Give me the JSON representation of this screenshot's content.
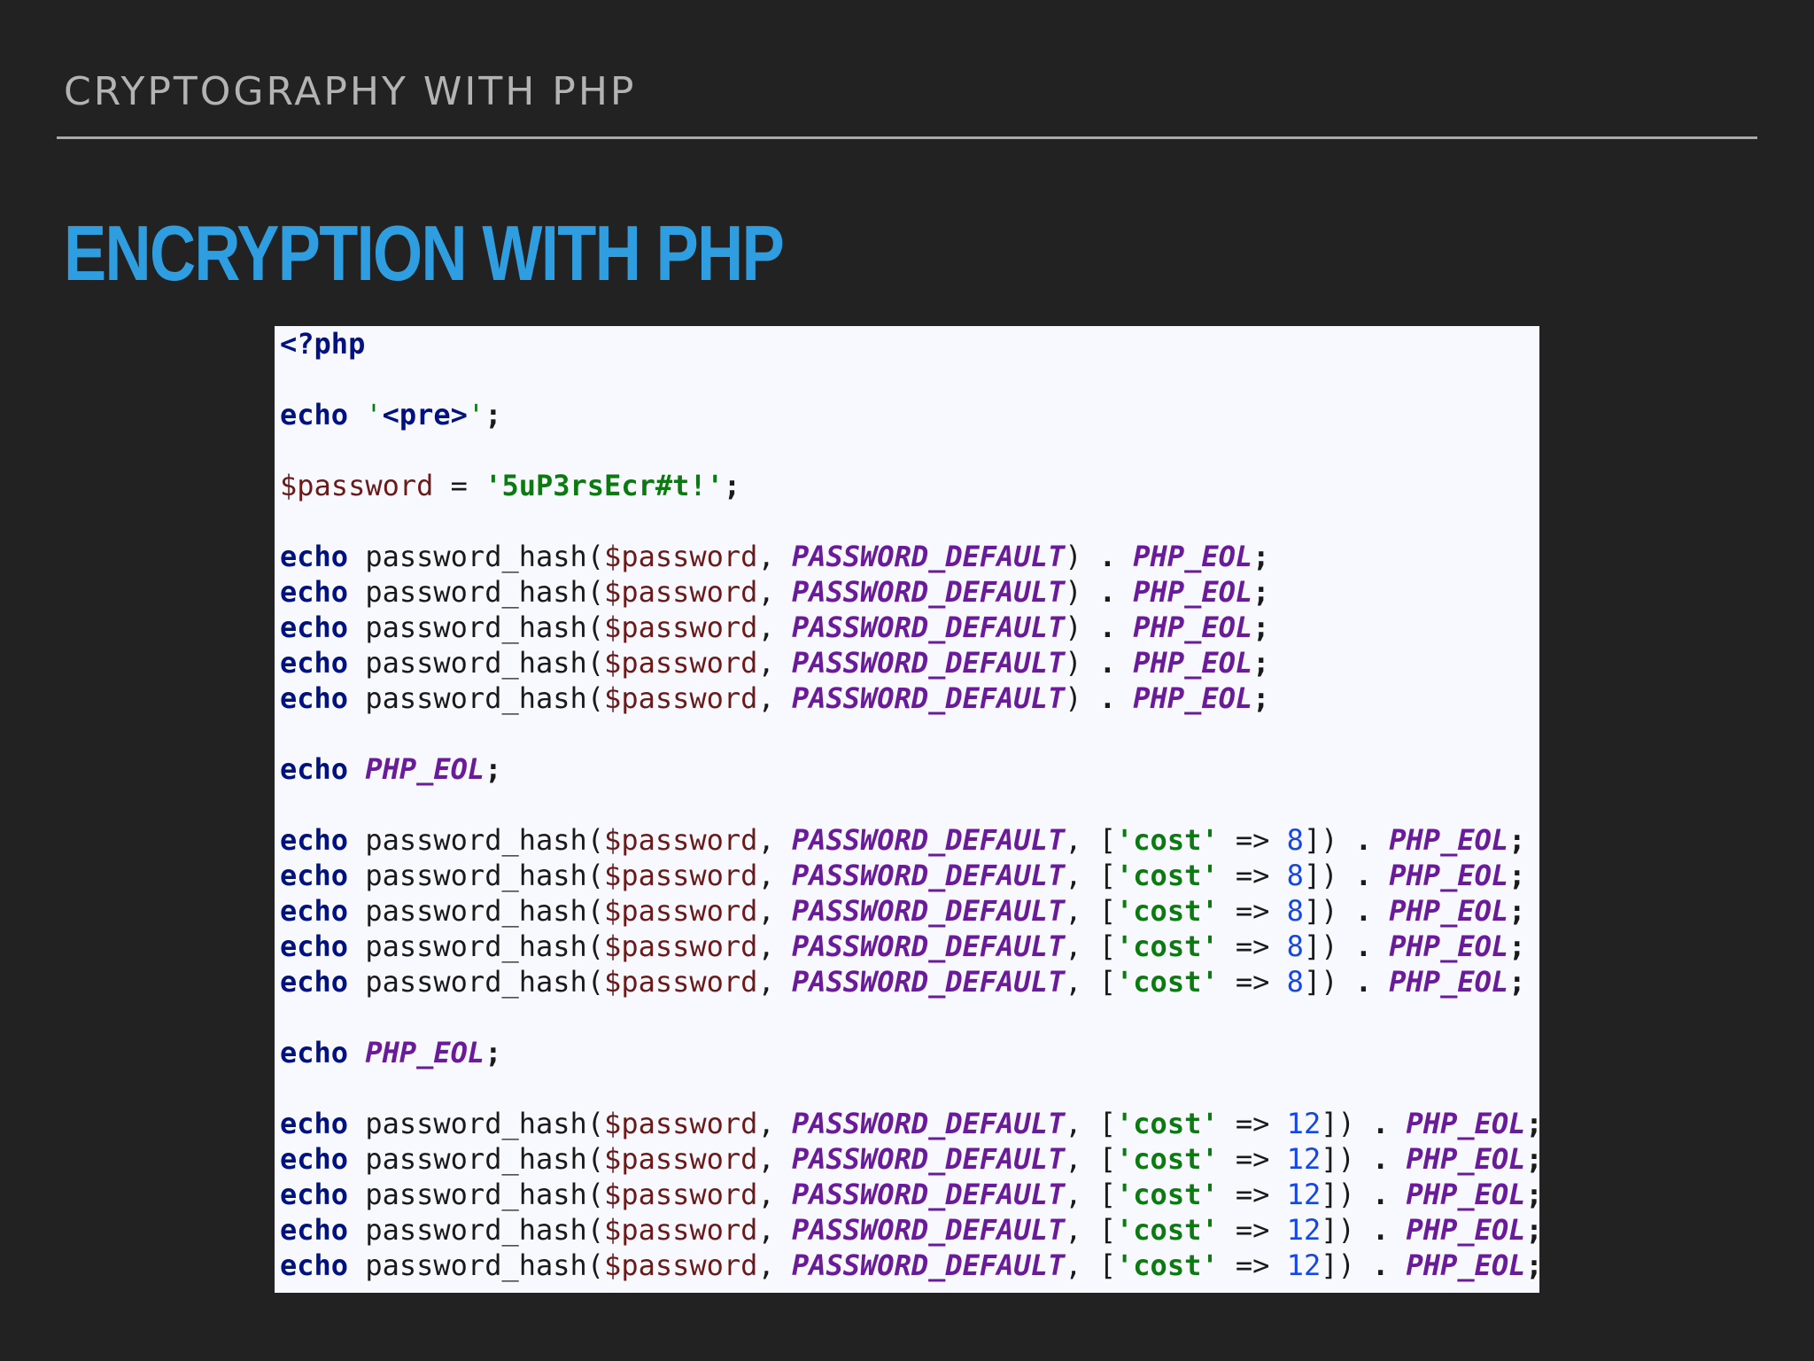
{
  "header": {
    "title": "CRYPTOGRAPHY WITH PHP"
  },
  "slide": {
    "title": "ENCRYPTION WITH PHP"
  },
  "code": {
    "language": "php",
    "lines": [
      [
        {
          "t": "<?php",
          "c": "kw"
        }
      ],
      [],
      [
        {
          "t": "echo",
          "c": "kw"
        },
        {
          "t": " ",
          "c": "punc"
        },
        {
          "t": "'",
          "c": "strq"
        },
        {
          "t": "<pre>",
          "c": "kw"
        },
        {
          "t": "'",
          "c": "strq"
        },
        {
          "t": ";",
          "c": "op"
        }
      ],
      [],
      [
        {
          "t": "$password",
          "c": "var"
        },
        {
          "t": " = ",
          "c": "punc"
        },
        {
          "t": "'5uP3rsEcr#t!'",
          "c": "str"
        },
        {
          "t": ";",
          "c": "op"
        }
      ],
      [],
      [
        {
          "t": "echo",
          "c": "kw"
        },
        {
          "t": " password_hash(",
          "c": "fn"
        },
        {
          "t": "$password",
          "c": "var"
        },
        {
          "t": ", ",
          "c": "punc"
        },
        {
          "t": "PASSWORD_DEFAULT",
          "c": "const"
        },
        {
          "t": ") ",
          "c": "punc"
        },
        {
          "t": ".",
          "c": "op"
        },
        {
          "t": " ",
          "c": "punc"
        },
        {
          "t": "PHP_EOL",
          "c": "const"
        },
        {
          "t": ";",
          "c": "op"
        }
      ],
      [
        {
          "t": "echo",
          "c": "kw"
        },
        {
          "t": " password_hash(",
          "c": "fn"
        },
        {
          "t": "$password",
          "c": "var"
        },
        {
          "t": ", ",
          "c": "punc"
        },
        {
          "t": "PASSWORD_DEFAULT",
          "c": "const"
        },
        {
          "t": ") ",
          "c": "punc"
        },
        {
          "t": ".",
          "c": "op"
        },
        {
          "t": " ",
          "c": "punc"
        },
        {
          "t": "PHP_EOL",
          "c": "const"
        },
        {
          "t": ";",
          "c": "op"
        }
      ],
      [
        {
          "t": "echo",
          "c": "kw"
        },
        {
          "t": " password_hash(",
          "c": "fn"
        },
        {
          "t": "$password",
          "c": "var"
        },
        {
          "t": ", ",
          "c": "punc"
        },
        {
          "t": "PASSWORD_DEFAULT",
          "c": "const"
        },
        {
          "t": ") ",
          "c": "punc"
        },
        {
          "t": ".",
          "c": "op"
        },
        {
          "t": " ",
          "c": "punc"
        },
        {
          "t": "PHP_EOL",
          "c": "const"
        },
        {
          "t": ";",
          "c": "op"
        }
      ],
      [
        {
          "t": "echo",
          "c": "kw"
        },
        {
          "t": " password_hash(",
          "c": "fn"
        },
        {
          "t": "$password",
          "c": "var"
        },
        {
          "t": ", ",
          "c": "punc"
        },
        {
          "t": "PASSWORD_DEFAULT",
          "c": "const"
        },
        {
          "t": ") ",
          "c": "punc"
        },
        {
          "t": ".",
          "c": "op"
        },
        {
          "t": " ",
          "c": "punc"
        },
        {
          "t": "PHP_EOL",
          "c": "const"
        },
        {
          "t": ";",
          "c": "op"
        }
      ],
      [
        {
          "t": "echo",
          "c": "kw"
        },
        {
          "t": " password_hash(",
          "c": "fn"
        },
        {
          "t": "$password",
          "c": "var"
        },
        {
          "t": ", ",
          "c": "punc"
        },
        {
          "t": "PASSWORD_DEFAULT",
          "c": "const"
        },
        {
          "t": ") ",
          "c": "punc"
        },
        {
          "t": ".",
          "c": "op"
        },
        {
          "t": " ",
          "c": "punc"
        },
        {
          "t": "PHP_EOL",
          "c": "const"
        },
        {
          "t": ";",
          "c": "op"
        }
      ],
      [],
      [
        {
          "t": "echo",
          "c": "kw"
        },
        {
          "t": " ",
          "c": "punc"
        },
        {
          "t": "PHP_EOL",
          "c": "const"
        },
        {
          "t": ";",
          "c": "op"
        }
      ],
      [],
      [
        {
          "t": "echo",
          "c": "kw"
        },
        {
          "t": " password_hash(",
          "c": "fn"
        },
        {
          "t": "$password",
          "c": "var"
        },
        {
          "t": ", ",
          "c": "punc"
        },
        {
          "t": "PASSWORD_DEFAULT",
          "c": "const"
        },
        {
          "t": ", [",
          "c": "punc"
        },
        {
          "t": "'cost'",
          "c": "str"
        },
        {
          "t": " => ",
          "c": "punc"
        },
        {
          "t": "8",
          "c": "num"
        },
        {
          "t": "]) ",
          "c": "punc"
        },
        {
          "t": ".",
          "c": "op"
        },
        {
          "t": " ",
          "c": "punc"
        },
        {
          "t": "PHP_EOL",
          "c": "const"
        },
        {
          "t": ";",
          "c": "op"
        }
      ],
      [
        {
          "t": "echo",
          "c": "kw"
        },
        {
          "t": " password_hash(",
          "c": "fn"
        },
        {
          "t": "$password",
          "c": "var"
        },
        {
          "t": ", ",
          "c": "punc"
        },
        {
          "t": "PASSWORD_DEFAULT",
          "c": "const"
        },
        {
          "t": ", [",
          "c": "punc"
        },
        {
          "t": "'cost'",
          "c": "str"
        },
        {
          "t": " => ",
          "c": "punc"
        },
        {
          "t": "8",
          "c": "num"
        },
        {
          "t": "]) ",
          "c": "punc"
        },
        {
          "t": ".",
          "c": "op"
        },
        {
          "t": " ",
          "c": "punc"
        },
        {
          "t": "PHP_EOL",
          "c": "const"
        },
        {
          "t": ";",
          "c": "op"
        }
      ],
      [
        {
          "t": "echo",
          "c": "kw"
        },
        {
          "t": " password_hash(",
          "c": "fn"
        },
        {
          "t": "$password",
          "c": "var"
        },
        {
          "t": ", ",
          "c": "punc"
        },
        {
          "t": "PASSWORD_DEFAULT",
          "c": "const"
        },
        {
          "t": ", [",
          "c": "punc"
        },
        {
          "t": "'cost'",
          "c": "str"
        },
        {
          "t": " => ",
          "c": "punc"
        },
        {
          "t": "8",
          "c": "num"
        },
        {
          "t": "]) ",
          "c": "punc"
        },
        {
          "t": ".",
          "c": "op"
        },
        {
          "t": " ",
          "c": "punc"
        },
        {
          "t": "PHP_EOL",
          "c": "const"
        },
        {
          "t": ";",
          "c": "op"
        }
      ],
      [
        {
          "t": "echo",
          "c": "kw"
        },
        {
          "t": " password_hash(",
          "c": "fn"
        },
        {
          "t": "$password",
          "c": "var"
        },
        {
          "t": ", ",
          "c": "punc"
        },
        {
          "t": "PASSWORD_DEFAULT",
          "c": "const"
        },
        {
          "t": ", [",
          "c": "punc"
        },
        {
          "t": "'cost'",
          "c": "str"
        },
        {
          "t": " => ",
          "c": "punc"
        },
        {
          "t": "8",
          "c": "num"
        },
        {
          "t": "]) ",
          "c": "punc"
        },
        {
          "t": ".",
          "c": "op"
        },
        {
          "t": " ",
          "c": "punc"
        },
        {
          "t": "PHP_EOL",
          "c": "const"
        },
        {
          "t": ";",
          "c": "op"
        }
      ],
      [
        {
          "t": "echo",
          "c": "kw"
        },
        {
          "t": " password_hash(",
          "c": "fn"
        },
        {
          "t": "$password",
          "c": "var"
        },
        {
          "t": ", ",
          "c": "punc"
        },
        {
          "t": "PASSWORD_DEFAULT",
          "c": "const"
        },
        {
          "t": ", [",
          "c": "punc"
        },
        {
          "t": "'cost'",
          "c": "str"
        },
        {
          "t": " => ",
          "c": "punc"
        },
        {
          "t": "8",
          "c": "num"
        },
        {
          "t": "]) ",
          "c": "punc"
        },
        {
          "t": ".",
          "c": "op"
        },
        {
          "t": " ",
          "c": "punc"
        },
        {
          "t": "PHP_EOL",
          "c": "const"
        },
        {
          "t": ";",
          "c": "op"
        }
      ],
      [],
      [
        {
          "t": "echo",
          "c": "kw"
        },
        {
          "t": " ",
          "c": "punc"
        },
        {
          "t": "PHP_EOL",
          "c": "const"
        },
        {
          "t": ";",
          "c": "op"
        }
      ],
      [],
      [
        {
          "t": "echo",
          "c": "kw"
        },
        {
          "t": " password_hash(",
          "c": "fn"
        },
        {
          "t": "$password",
          "c": "var"
        },
        {
          "t": ", ",
          "c": "punc"
        },
        {
          "t": "PASSWORD_DEFAULT",
          "c": "const"
        },
        {
          "t": ", [",
          "c": "punc"
        },
        {
          "t": "'cost'",
          "c": "str"
        },
        {
          "t": " => ",
          "c": "punc"
        },
        {
          "t": "12",
          "c": "num"
        },
        {
          "t": "]) ",
          "c": "punc"
        },
        {
          "t": ".",
          "c": "op"
        },
        {
          "t": " ",
          "c": "punc"
        },
        {
          "t": "PHP_EOL",
          "c": "const"
        },
        {
          "t": ";",
          "c": "op"
        }
      ],
      [
        {
          "t": "echo",
          "c": "kw"
        },
        {
          "t": " password_hash(",
          "c": "fn"
        },
        {
          "t": "$password",
          "c": "var"
        },
        {
          "t": ", ",
          "c": "punc"
        },
        {
          "t": "PASSWORD_DEFAULT",
          "c": "const"
        },
        {
          "t": ", [",
          "c": "punc"
        },
        {
          "t": "'cost'",
          "c": "str"
        },
        {
          "t": " => ",
          "c": "punc"
        },
        {
          "t": "12",
          "c": "num"
        },
        {
          "t": "]) ",
          "c": "punc"
        },
        {
          "t": ".",
          "c": "op"
        },
        {
          "t": " ",
          "c": "punc"
        },
        {
          "t": "PHP_EOL",
          "c": "const"
        },
        {
          "t": ";",
          "c": "op"
        }
      ],
      [
        {
          "t": "echo",
          "c": "kw"
        },
        {
          "t": " password_hash(",
          "c": "fn"
        },
        {
          "t": "$password",
          "c": "var"
        },
        {
          "t": ", ",
          "c": "punc"
        },
        {
          "t": "PASSWORD_DEFAULT",
          "c": "const"
        },
        {
          "t": ", [",
          "c": "punc"
        },
        {
          "t": "'cost'",
          "c": "str"
        },
        {
          "t": " => ",
          "c": "punc"
        },
        {
          "t": "12",
          "c": "num"
        },
        {
          "t": "]) ",
          "c": "punc"
        },
        {
          "t": ".",
          "c": "op"
        },
        {
          "t": " ",
          "c": "punc"
        },
        {
          "t": "PHP_EOL",
          "c": "const"
        },
        {
          "t": ";",
          "c": "op"
        }
      ],
      [
        {
          "t": "echo",
          "c": "kw"
        },
        {
          "t": " password_hash(",
          "c": "fn"
        },
        {
          "t": "$password",
          "c": "var"
        },
        {
          "t": ", ",
          "c": "punc"
        },
        {
          "t": "PASSWORD_DEFAULT",
          "c": "const"
        },
        {
          "t": ", [",
          "c": "punc"
        },
        {
          "t": "'cost'",
          "c": "str"
        },
        {
          "t": " => ",
          "c": "punc"
        },
        {
          "t": "12",
          "c": "num"
        },
        {
          "t": "]) ",
          "c": "punc"
        },
        {
          "t": ".",
          "c": "op"
        },
        {
          "t": " ",
          "c": "punc"
        },
        {
          "t": "PHP_EOL",
          "c": "const"
        },
        {
          "t": ";",
          "c": "op"
        }
      ],
      [
        {
          "t": "echo",
          "c": "kw"
        },
        {
          "t": " password_hash(",
          "c": "fn"
        },
        {
          "t": "$password",
          "c": "var"
        },
        {
          "t": ", ",
          "c": "punc"
        },
        {
          "t": "PASSWORD_DEFAULT",
          "c": "const"
        },
        {
          "t": ", [",
          "c": "punc"
        },
        {
          "t": "'cost'",
          "c": "str"
        },
        {
          "t": " => ",
          "c": "punc"
        },
        {
          "t": "12",
          "c": "num"
        },
        {
          "t": "]) ",
          "c": "punc"
        },
        {
          "t": ".",
          "c": "op"
        },
        {
          "t": " ",
          "c": "punc"
        },
        {
          "t": "PHP_EOL",
          "c": "const"
        },
        {
          "t": ";",
          "c": "op"
        }
      ]
    ]
  }
}
